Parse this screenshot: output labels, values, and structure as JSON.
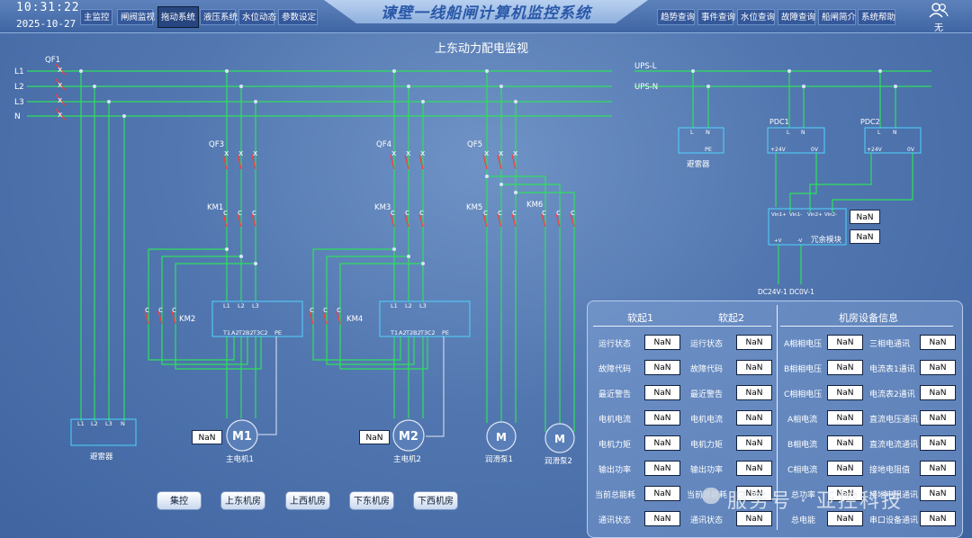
{
  "header": {
    "time": "10:31:22",
    "date": "2025-10-27",
    "app_title": "谏壁一线船闸计算机监控系统",
    "user_label": "无",
    "nav_left": [
      "主监控",
      "闸阀监视",
      "拖动系统",
      "液压系统",
      "水位动态",
      "参数设定"
    ],
    "nav_right": [
      "趋势查询",
      "事件查询",
      "水位查询",
      "故障查询",
      "船闸简介",
      "系统帮助"
    ],
    "active_tab": "拖动系统"
  },
  "page_title": "上东动力配电监视",
  "diagram": {
    "bus_labels": [
      "L1",
      "L2",
      "L3",
      "N"
    ],
    "ups_labels": [
      "UPS-L",
      "UPS-N"
    ],
    "breakers": [
      "QF1",
      "QF3",
      "QF4",
      "QF5"
    ],
    "contactors": [
      "KM1",
      "KM3",
      "KM5",
      "KM6",
      "KM2",
      "KM4"
    ],
    "softstart_top": [
      "L1",
      "L2",
      "L3"
    ],
    "softstart_bottom": [
      "T1",
      "A2",
      "T2",
      "B2",
      "T3",
      "C2",
      "PE"
    ],
    "arrester_terms": [
      "L1",
      "L2",
      "L3",
      "N"
    ],
    "arrester_label": "避雷器",
    "ups_arrester_terms": [
      "L",
      "N",
      "PE"
    ],
    "ups_arrester_label": "避雷器",
    "pdc1_label": "PDC1",
    "pdc2_label": "PDC2",
    "pdc_terms": [
      "L",
      "N",
      "+24V",
      "0V"
    ],
    "redundant_terms": [
      "Vin1+",
      "Vin1-",
      "Vin2+",
      "Vin2-"
    ],
    "redundant_out": [
      "+V",
      "-V"
    ],
    "redundant_label": "冗余模块",
    "dc_outputs": [
      "DC24V-1",
      "DC0V-1"
    ],
    "motors": [
      {
        "symbol": "M1",
        "label": "主电机1"
      },
      {
        "symbol": "M2",
        "label": "主电机2"
      },
      {
        "symbol": "M",
        "label": "润滑泵1"
      },
      {
        "symbol": "M",
        "label": "润滑泵2"
      }
    ],
    "nan": "NaN"
  },
  "info": {
    "headers": [
      "软起1",
      "软起2",
      "机房设备信息"
    ],
    "soft_labels": [
      "运行状态",
      "故障代码",
      "最近警告",
      "电机电流",
      "电机力矩",
      "输出功率",
      "当前总能耗",
      "通讯状态"
    ],
    "room_left_labels": [
      "A相相电压",
      "B相相电压",
      "C相相电压",
      "A相电流",
      "B相电流",
      "C相电流",
      "总功率",
      "总电能"
    ],
    "room_right_labels": [
      "三相电通讯",
      "电流表1通讯",
      "电流表2通讯",
      "直流电压通讯",
      "直流电流通讯",
      "接地电阻值",
      "接地电阻通讯",
      "串口设备通讯"
    ],
    "value": "NaN"
  },
  "bottom_buttons": [
    "集控",
    "上东机房",
    "上西机房",
    "下东机房",
    "下西机房"
  ],
  "watermark": "服务号 · 亚控科技",
  "colors": {
    "wire": "#2ee05c",
    "switch": "#ff3b3b",
    "background": "#5277b0"
  }
}
